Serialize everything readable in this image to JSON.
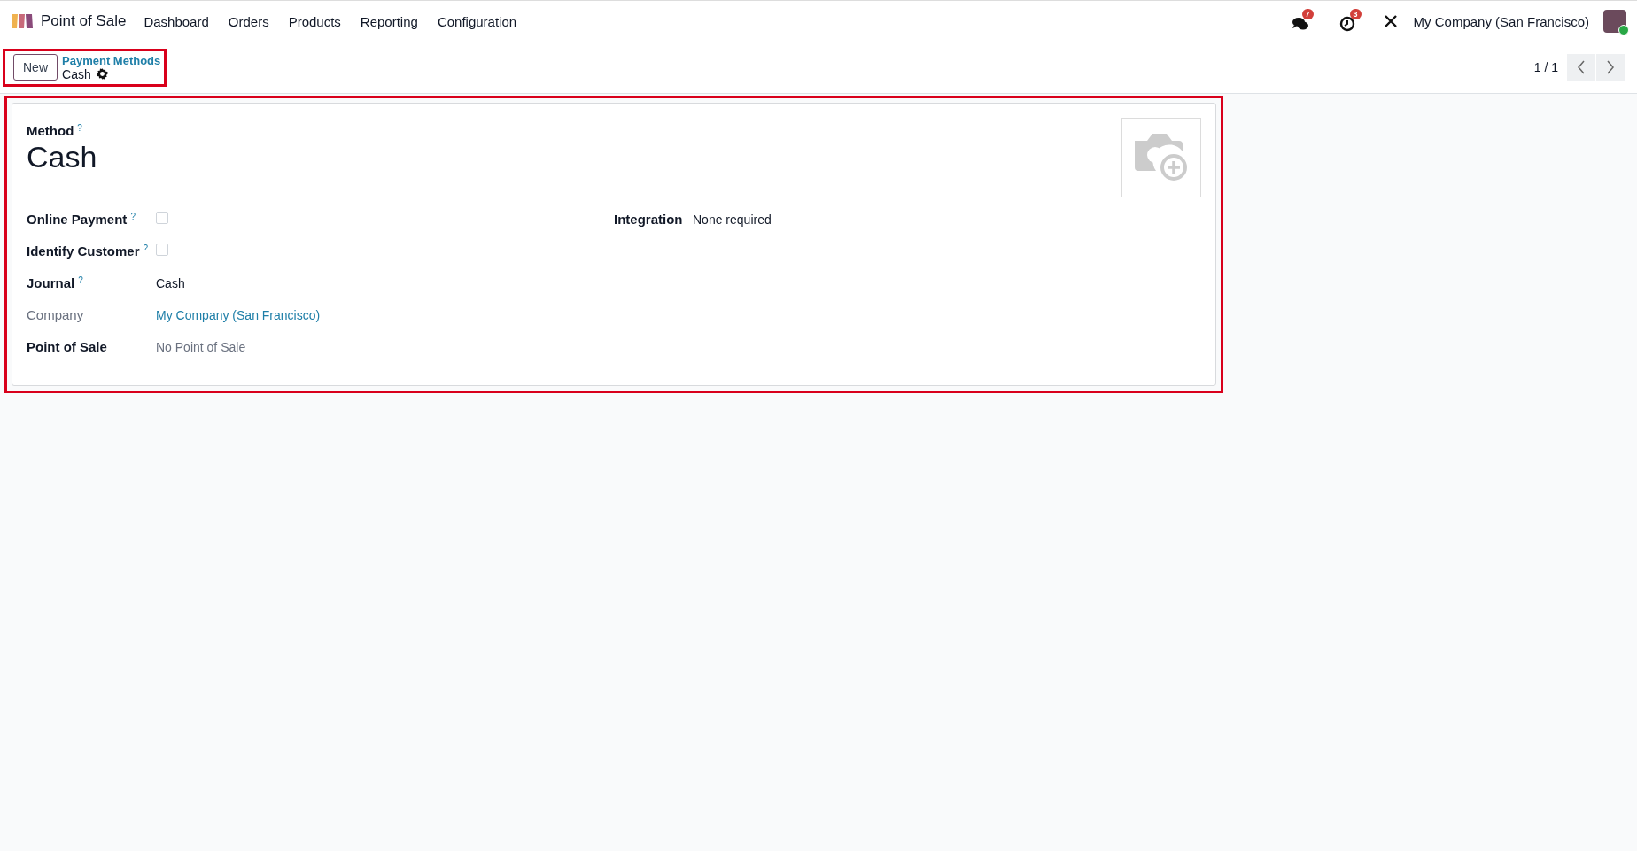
{
  "navbar": {
    "app_name": "Point of Sale",
    "menu": [
      {
        "label": "Dashboard"
      },
      {
        "label": "Orders"
      },
      {
        "label": "Products"
      },
      {
        "label": "Reporting"
      },
      {
        "label": "Configuration"
      }
    ],
    "messages_count": "7",
    "activities_count": "3",
    "company": "My Company (San Francisco)"
  },
  "control_panel": {
    "new_button": "New",
    "breadcrumb": "Payment Methods",
    "record": "Cash",
    "pager": "1 / 1"
  },
  "form": {
    "method_label": "Method",
    "method_help": "?",
    "method_name": "Cash",
    "left_fields": [
      {
        "label": "Online Payment",
        "help": "?",
        "kind": "checkbox",
        "checked": false,
        "readonly": false
      },
      {
        "label": "Identify Customer",
        "help": "?",
        "kind": "checkbox",
        "checked": false,
        "readonly": false
      },
      {
        "label": "Journal",
        "help": "?",
        "kind": "text",
        "value": "Cash",
        "readonly": false
      },
      {
        "label": "Company",
        "kind": "link",
        "value": "My Company (San Francisco)",
        "readonly": true
      },
      {
        "label": "Point of Sale",
        "kind": "placeholder",
        "value": "No Point of Sale",
        "readonly": false
      }
    ],
    "right_fields": [
      {
        "label": "Integration",
        "kind": "text",
        "value": "None required",
        "readonly": false
      }
    ]
  }
}
